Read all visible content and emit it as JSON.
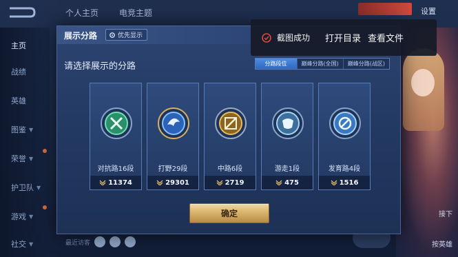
{
  "top_tabs": [
    "个人主页",
    "电竞主题"
  ],
  "top_right": {
    "settings_label": "设置"
  },
  "side_nav": [
    "主页",
    "战绩",
    "英雄",
    "图鉴",
    "荣誉",
    "护卫队",
    "游戏",
    "社交"
  ],
  "right_panel": {
    "upper_label": "接下",
    "lower_label": "按英雄"
  },
  "visitors_label": "最近访客",
  "modal": {
    "title": "展示分路",
    "priority_chip": "优先显示",
    "prompt": "请选择展示的分路",
    "segments": [
      "分路段位",
      "巅峰分路(全国)",
      "巅峰分路(战区)"
    ],
    "selected_segment": "分路段位",
    "cards": [
      {
        "name": "对抗路16段",
        "score": "11374",
        "icon": "clash-lane-emblem-icon",
        "accent": "#37c08a"
      },
      {
        "name": "打野29段",
        "score": "29301",
        "icon": "jungle-emblem-icon",
        "accent": "#3f8ee8"
      },
      {
        "name": "中路6段",
        "score": "2719",
        "icon": "mid-lane-emblem-icon",
        "accent": "#d6a33f"
      },
      {
        "name": "游走1段",
        "score": "475",
        "icon": "roam-emblem-icon",
        "accent": "#6fb6e6"
      },
      {
        "name": "发育路4段",
        "score": "1516",
        "icon": "farm-lane-emblem-icon",
        "accent": "#5aa7ea"
      }
    ],
    "confirm_label": "确定"
  },
  "toast": {
    "message": "截图成功",
    "open_folder": "打开目录",
    "view_file": "查看文件",
    "status_color": "#e0463d"
  }
}
